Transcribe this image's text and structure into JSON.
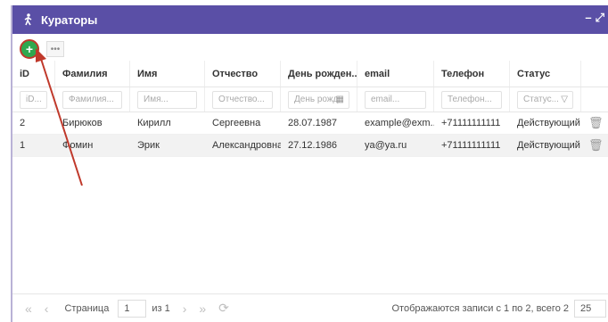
{
  "window": {
    "title": "Кураторы",
    "icon": "person-walking-icon",
    "controls": [
      "–",
      "⤢"
    ]
  },
  "toolbar": {
    "add_label": "+",
    "more_label": "•••"
  },
  "columns": [
    "iD",
    "Фамилия",
    "Имя",
    "Отчество",
    "День рожден...",
    "email",
    "Телефон",
    "Статус"
  ],
  "filters": [
    "iD...",
    "Фамилия...",
    "Имя...",
    "Отчество...",
    "День рожд",
    "email...",
    "Телефон...",
    "Статус..."
  ],
  "rows": [
    [
      "2",
      "Бирюков",
      "Кирилл",
      "Сергеевна",
      "28.07.1987",
      "example@exm...",
      "+71111111111",
      "Действующий"
    ],
    [
      "1",
      "Фомин",
      "Эрик",
      "Александровна",
      "27.12.1986",
      "ya@ya.ru",
      "+71111111111",
      "Действующий"
    ]
  ],
  "pager": {
    "first": "«",
    "prev": "‹",
    "next": "›",
    "last": "»",
    "refresh": "⟳",
    "page_label": "Страница",
    "page_value": "1",
    "of_label": "из 1",
    "info": "Отображаются записи с 1 по 2, всего 2",
    "page_size": "25"
  },
  "colors": {
    "titlebar": "#5a4fa6",
    "add_button": "#2fa84f",
    "annotation": "#c0392b"
  }
}
